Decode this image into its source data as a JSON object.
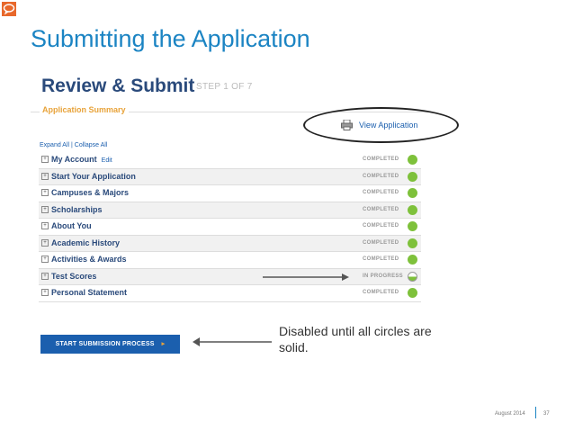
{
  "slide": {
    "title": "Submitting the Application",
    "footer_date": "August 2014",
    "page_number": "37",
    "accent_color": "#1b84c3"
  },
  "screen": {
    "title": "Review & Submit",
    "step": "STEP 1 OF 7",
    "summary_label": "Application Summary",
    "view_link": "View Application",
    "expand_collapse": "Expand All | Collapse All",
    "sections": [
      {
        "label": "My Account",
        "edit": "Edit",
        "status": "COMPLETED",
        "state": "complete"
      },
      {
        "label": "Start Your Application",
        "status": "COMPLETED",
        "state": "complete"
      },
      {
        "label": "Campuses & Majors",
        "status": "COMPLETED",
        "state": "complete"
      },
      {
        "label": "Scholarships",
        "status": "COMPLETED",
        "state": "complete"
      },
      {
        "label": "About You",
        "status": "COMPLETED",
        "state": "complete"
      },
      {
        "label": "Academic History",
        "status": "COMPLETED",
        "state": "complete"
      },
      {
        "label": "Activities & Awards",
        "status": "COMPLETED",
        "state": "complete"
      },
      {
        "label": "Test Scores",
        "status": "IN PROGRESS",
        "state": "half"
      },
      {
        "label": "Personal Statement",
        "status": "COMPLETED",
        "state": "complete"
      }
    ],
    "submit_button": "START SUBMISSION PROCESS",
    "submit_chevron": "▸"
  },
  "annotation": {
    "note": "Disabled until all circles are solid."
  },
  "icons": {
    "corner": "speech-bubble-icon",
    "printer": "printer-icon"
  }
}
